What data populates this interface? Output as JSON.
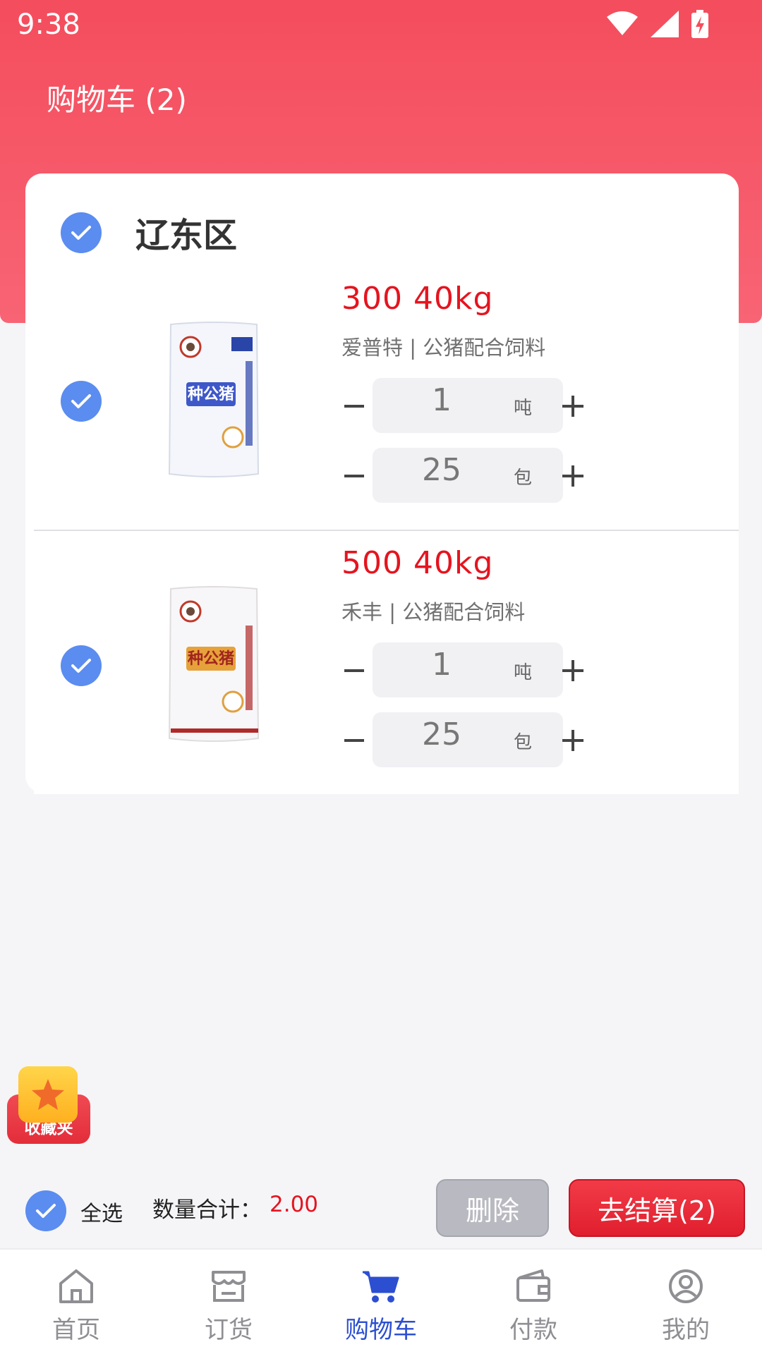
{
  "status_bar": {
    "time": "9:38"
  },
  "header": {
    "title": "购物车 (2)"
  },
  "store": {
    "name": "辽东区"
  },
  "items": [
    {
      "price": "300 40kg",
      "description": "爱普特 | 公猪配合饲料",
      "bag_label": "种公猪",
      "quantity_ton": "1",
      "unit_ton": "吨",
      "quantity_bag": "25",
      "unit_bag": "包"
    },
    {
      "price": "500 40kg",
      "description": "禾丰 | 公猪配合饲料",
      "bag_label": "种公猪",
      "quantity_ton": "1",
      "unit_ton": "吨",
      "quantity_bag": "25",
      "unit_bag": "包"
    }
  ],
  "favorites": {
    "label": "收藏夹"
  },
  "footer": {
    "select_all": "全选",
    "total_label": "数量合计：",
    "total_value": "2.00",
    "delete_button": "删除",
    "checkout_button": "去结算(2)"
  },
  "tabs": [
    {
      "label": "首页",
      "icon": "home-icon"
    },
    {
      "label": "订货",
      "icon": "store-icon"
    },
    {
      "label": "购物车",
      "icon": "cart-icon",
      "active": true
    },
    {
      "label": "付款",
      "icon": "wallet-icon"
    },
    {
      "label": "我的",
      "icon": "user-icon"
    }
  ],
  "colors": {
    "header_red": "#f44d5d",
    "price_red": "#e5141f",
    "check_blue": "#5b8cf0",
    "tab_active": "#2c4fd1",
    "checkout_red": "#e01f2e"
  }
}
